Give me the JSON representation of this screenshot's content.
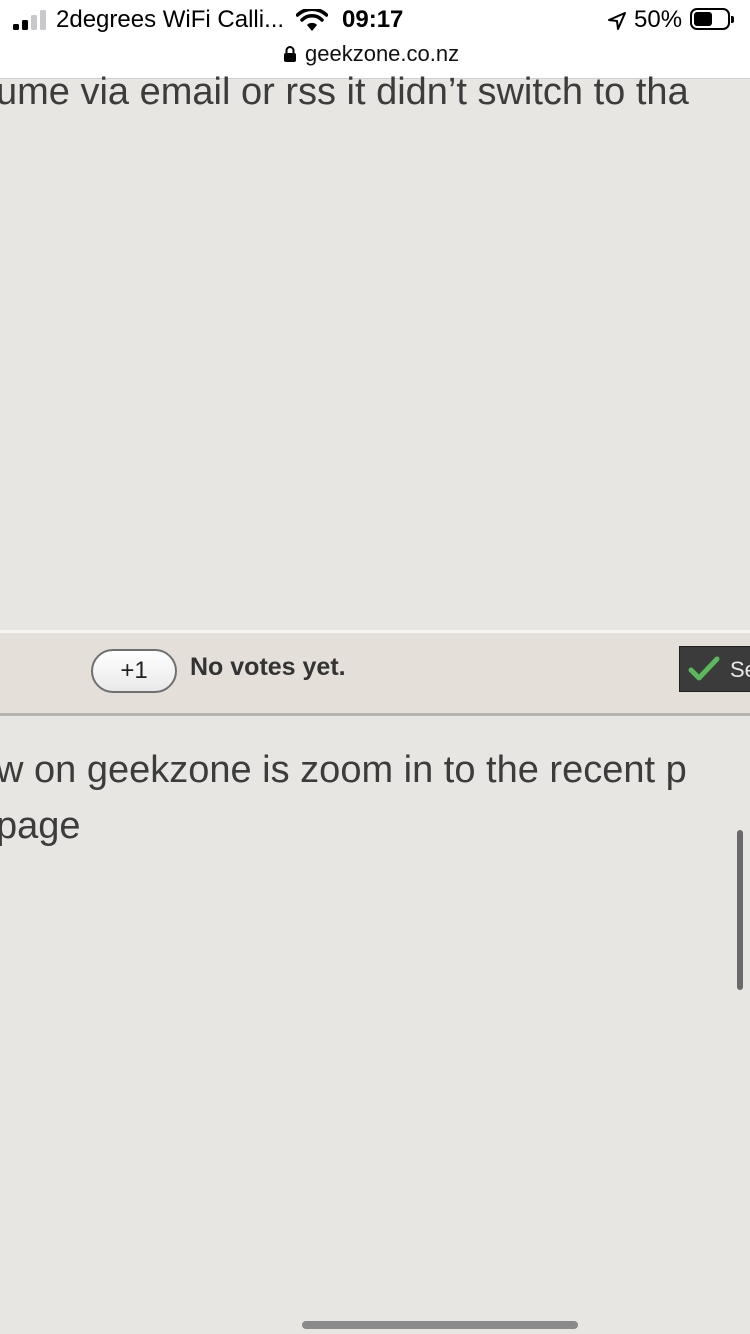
{
  "status_bar": {
    "carrier": "2degrees WiFi Calli...",
    "time": "09:17",
    "battery_percent": "50%",
    "battery_level": 0.5,
    "icons": [
      "signal-icon",
      "wifi-icon",
      "location-arrow-icon",
      "battery-icon"
    ]
  },
  "url_bar": {
    "domain": "geekzone.co.nz",
    "icon": "lock-icon"
  },
  "post": {
    "text_top": "ume via email or rss it didn’t switch to tha",
    "text_bottom_line1": "w on geekzone is zoom in to the recent p",
    "text_bottom_line2": " page"
  },
  "vote_bar": {
    "plus_one_label": "+1",
    "status": "No votes yet.",
    "solution_button_label": "Se"
  },
  "colors": {
    "page_background": "#e8e6e2",
    "vote_band": "#e5dfda",
    "check_green": "#5cb85c"
  }
}
